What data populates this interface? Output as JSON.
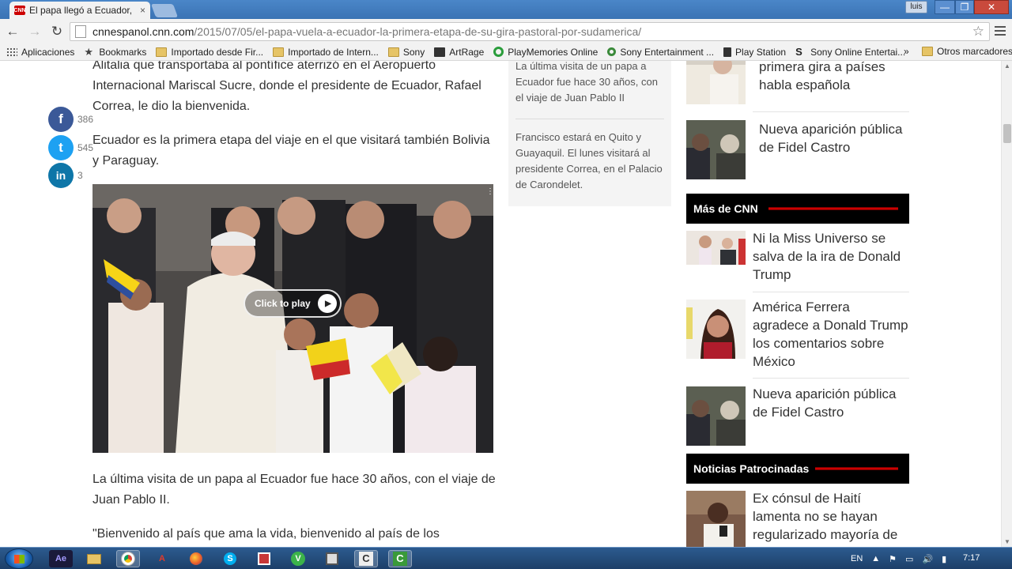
{
  "browser": {
    "tab_title": "El papa llegó a Ecuador, la",
    "tab_favicon": "CNN",
    "close_label": "×",
    "user_label": "luis",
    "window_min": "—",
    "window_max": "❐",
    "window_close": "✕",
    "back_icon": "←",
    "forward_icon": "→",
    "reload_icon": "↻",
    "url_host": "cnnespanol.cnn.com",
    "url_path": "/2015/07/05/el-papa-vuela-a-ecuador-la-primera-etapa-de-su-gira-pastoral-por-sudamerica/",
    "star_icon": "☆"
  },
  "bookmarks": {
    "items": [
      {
        "label": "Aplicaciones",
        "icon": "apps-icon"
      },
      {
        "label": "Bookmarks",
        "icon": "star-icon"
      },
      {
        "label": "Importado desde Fir...",
        "icon": "folder-icon"
      },
      {
        "label": "Importado de Intern...",
        "icon": "folder-icon"
      },
      {
        "label": "Sony",
        "icon": "folder-icon"
      },
      {
        "label": "ArtRage",
        "icon": "artrage-icon"
      },
      {
        "label": "PlayMemories Online",
        "icon": "playmemories-icon"
      },
      {
        "label": "Sony Entertainment ...",
        "icon": "sony-entertainment-icon"
      },
      {
        "label": "Play Station",
        "icon": "playstation-icon"
      },
      {
        "label": "Sony Online Entertai...",
        "icon": "sony-online-icon"
      }
    ],
    "more": "»",
    "other": "Otros marcadores"
  },
  "article": {
    "paragraphs": [
      "Alitalia que transportaba al pontífice aterrizó en el Aeropuerto Internacional Mariscal Sucre, donde el presidente de Ecuador, Rafael Correa, le dio la bienvenida.",
      "Ecuador es la primera etapa del viaje en el que visitará también Bolivia y Paraguay.",
      "La última visita de un papa al Ecuador fue hace 30 años, con el viaje de Juan Pablo II.",
      "\"Bienvenido al país que ama la vida, bienvenido al país de los"
    ],
    "video_cta": "Click to play"
  },
  "share": [
    {
      "network": "facebook",
      "glyph": "f",
      "count": "386",
      "color": "#3b5998"
    },
    {
      "network": "twitter",
      "glyph": "t",
      "count": "545",
      "color": "#1da1f2"
    },
    {
      "network": "linkedin",
      "glyph": "in",
      "count": "3",
      "color": "#0e76a8"
    }
  ],
  "highlights": [
    "La última visita de un papa a Ecuador fue hace 30 años, con el viaje de Juan Pablo II",
    "Francisco estará en Quito y Guayaquil. El lunes visitará al presidente Correa, en el Palacio de Carondelet."
  ],
  "rail": {
    "top_items": [
      "primera gira a países habla española",
      "Nueva aparición pública de Fidel Castro"
    ],
    "mas_de_cnn_title": "Más de CNN",
    "mas_de_cnn": [
      "Ni la Miss Universo se salva de la ira de Donald Trump",
      "América Ferrera agradece a Donald Trump los comentarios sobre México",
      "Nueva aparición pública de Fidel Castro"
    ],
    "sponsored_title": "Noticias Patrocinadas",
    "sponsored": [
      "Ex cónsul de Haití lamenta no se hayan regularizado mayoría de"
    ]
  },
  "taskbar": {
    "apps": [
      "Ae",
      "📁",
      "Chrome",
      "A",
      "Firefox",
      "S",
      "Ps",
      "V",
      "Ps2",
      "C",
      "C2"
    ],
    "lang": "EN",
    "time": "7:17"
  },
  "colors": {
    "cnn_red": "#cc0000",
    "facebook": "#3b5998",
    "twitter": "#1da1f2",
    "linkedin": "#0e76a8"
  }
}
